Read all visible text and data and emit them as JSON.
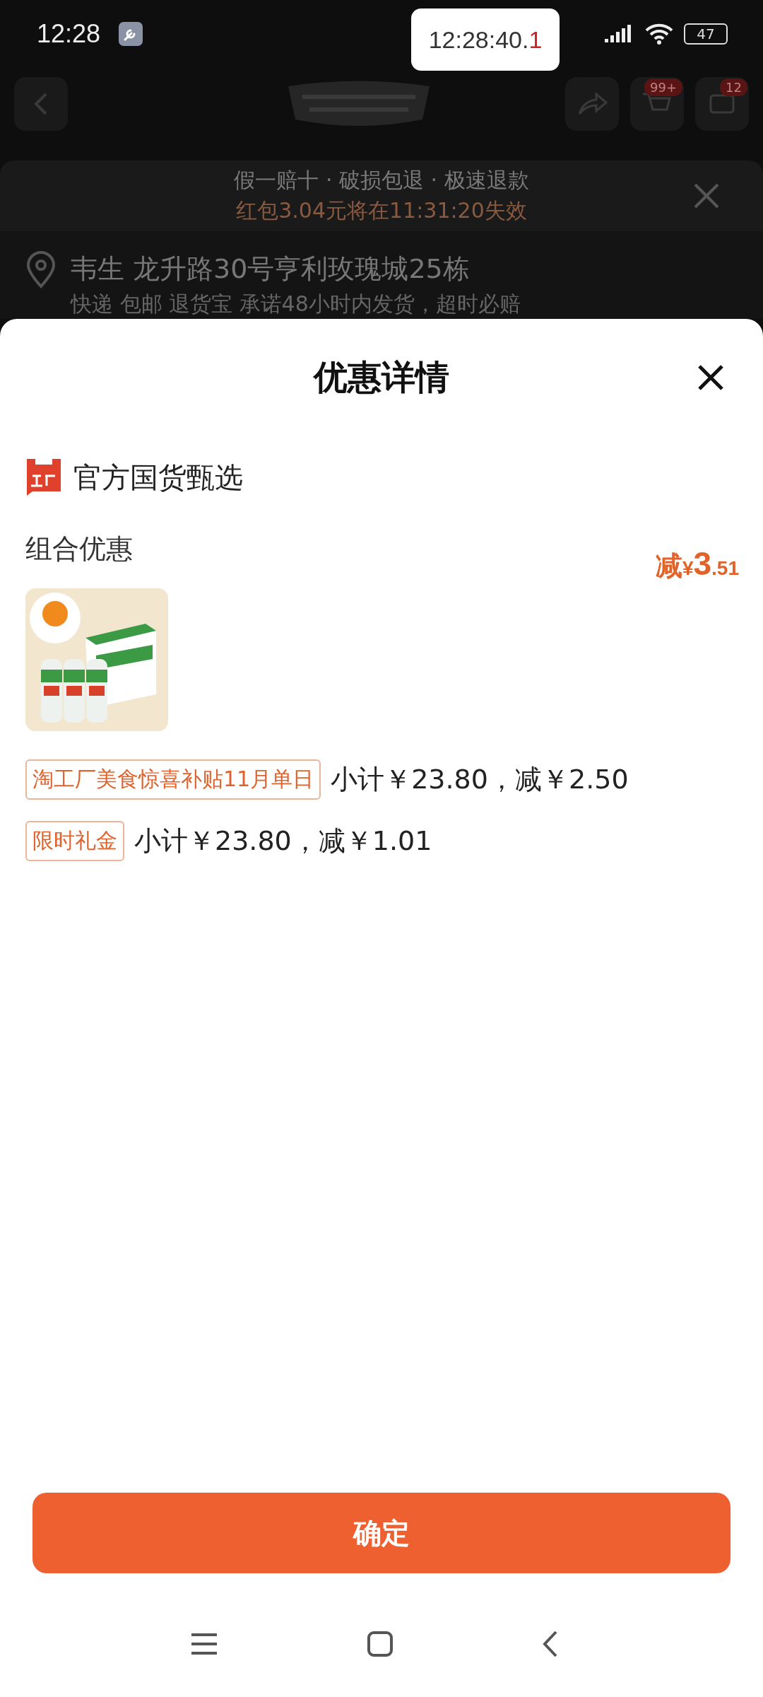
{
  "status_bar": {
    "time": "12:28",
    "battery": "47"
  },
  "clock_overlay": {
    "main": "12:28:40.",
    "tenth": "1"
  },
  "background_page": {
    "cart_badge": "99+",
    "message_badge": "12",
    "guarantee": "假一赔十 · 破损包退 · 极速退款",
    "coupon_expiry": "红包3.04元将在11:31:20失效",
    "address": "韦生 龙升路30号亨利玫瑰城25栋",
    "shipping": "快递 包邮 退货宝 承诺48小时内发货，超时必赔"
  },
  "sheet": {
    "title": "优惠详情",
    "store": "官方国货甄选",
    "section": "组合优惠",
    "discount": {
      "prefix": "减",
      "currency": "¥",
      "integer": "3",
      "decimal": ".51"
    },
    "promotions": [
      {
        "tag": "淘工厂美食惊喜补贴11月单日",
        "detail": "小计￥23.80，减￥2.50"
      },
      {
        "tag": "限时礼金",
        "detail": "小计￥23.80，减￥1.01"
      }
    ],
    "confirm_button": "确定"
  }
}
